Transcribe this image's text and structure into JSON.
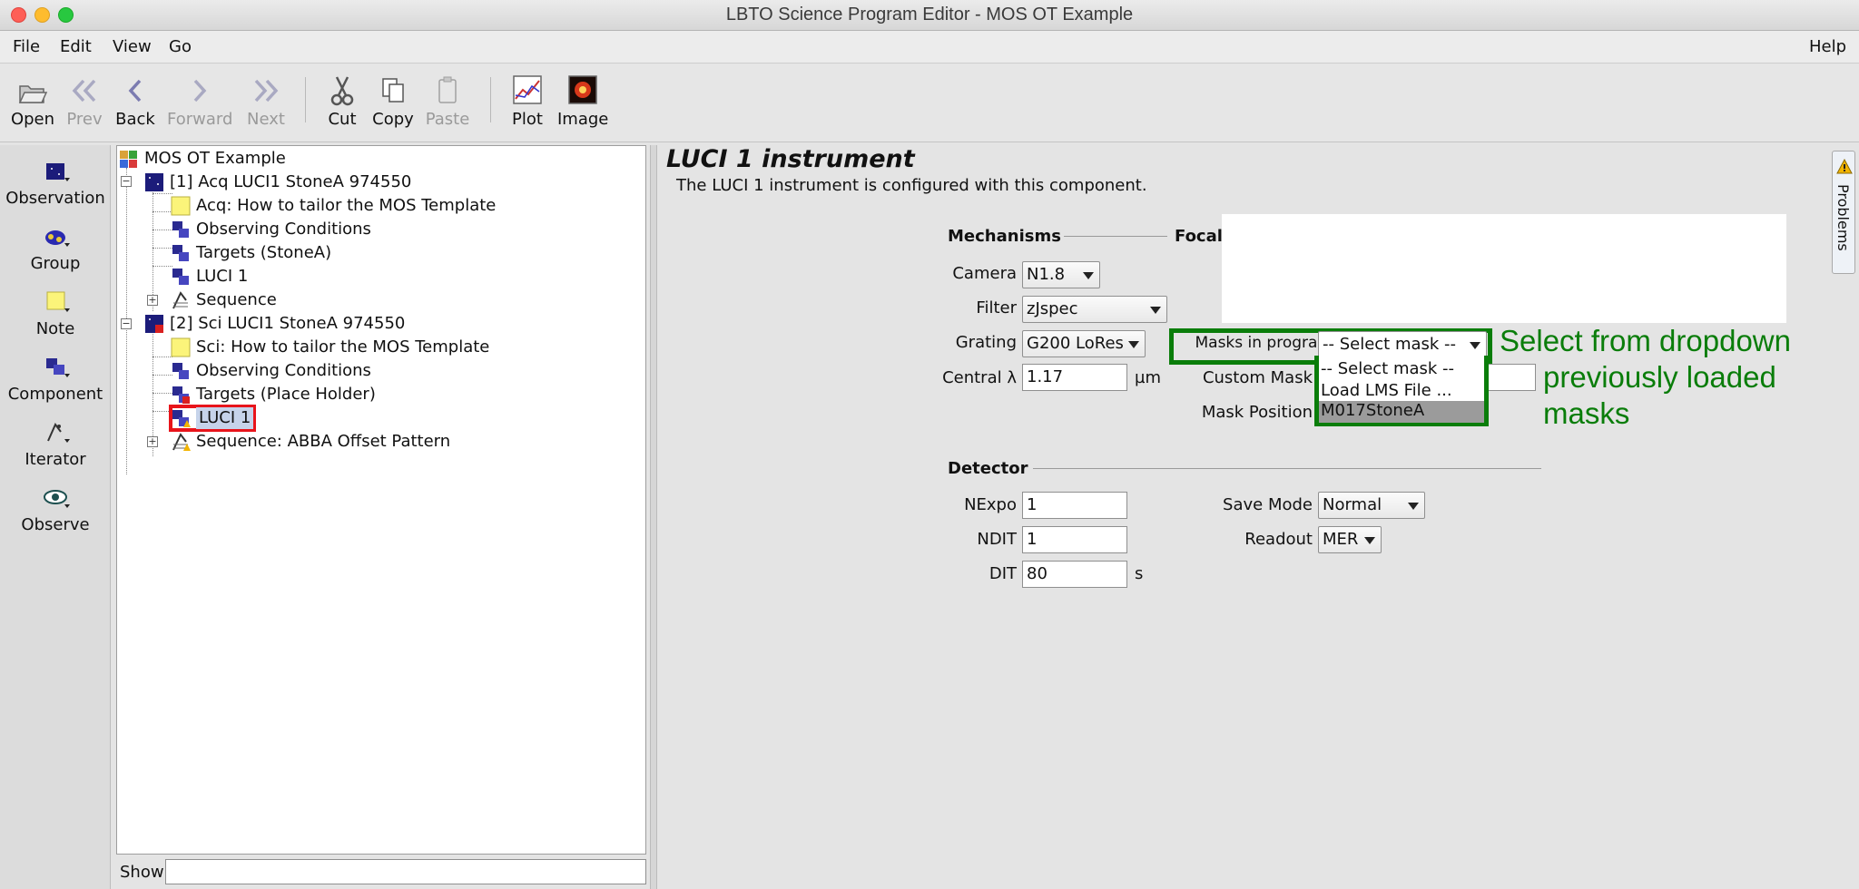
{
  "window": {
    "title": "LBTO Science Program Editor - MOS OT Example"
  },
  "menu": {
    "file": "File",
    "edit": "Edit",
    "view": "View",
    "go": "Go",
    "help": "Help"
  },
  "toolbar": {
    "open": "Open",
    "prev": "Prev",
    "back": "Back",
    "forward": "Forward",
    "next": "Next",
    "cut": "Cut",
    "copy": "Copy",
    "paste": "Paste",
    "plot": "Plot",
    "image": "Image"
  },
  "palette": {
    "observation": "Observation",
    "group": "Group",
    "note": "Note",
    "component": "Component",
    "iterator": "Iterator",
    "observe": "Observe"
  },
  "tree": {
    "root": "MOS OT Example",
    "obs1": "[1] Acq LUCI1 StoneA 974550",
    "obs1_note": "Acq: How to tailor the MOS Template",
    "obs1_conditions": "Observing Conditions",
    "obs1_targets": "Targets (StoneA)",
    "obs1_luci": "LUCI 1",
    "obs1_sequence": "Sequence",
    "obs2": "[2] Sci LUCI1 StoneA 974550",
    "obs2_note": "Sci: How to tailor the MOS Template",
    "obs2_conditions": "Observing Conditions",
    "obs2_targets": "Targets (Place Holder)",
    "obs2_luci": "LUCI 1",
    "obs2_sequence": "Sequence: ABBA Offset Pattern"
  },
  "show": {
    "label": "Show",
    "value": ""
  },
  "editor": {
    "heading": "LUCI 1 instrument",
    "description": "The LUCI 1 instrument is configured with this component.",
    "mechanisms": "Mechanisms",
    "focal": "Focal",
    "camera_label": "Camera",
    "camera_value": "N1.8",
    "filter_label": "Filter",
    "filter_value": "zJspec",
    "grating_label": "Grating",
    "grating_value": "G200 LoRes",
    "central_label": "Central λ",
    "central_value": "1.17",
    "central_unit": "µm",
    "masks_label": "Masks in program",
    "masks_value": "-- Select mask --",
    "mask_options": [
      "-- Select mask --",
      "Load LMS File ...",
      "M017StoneA"
    ],
    "custom_mask_label": "Custom Mask",
    "mask_position_label": "Mask Position",
    "detector": "Detector",
    "nexpo_label": "NExpo",
    "nexpo_value": "1",
    "ndit_label": "NDIT",
    "ndit_value": "1",
    "dit_label": "DIT",
    "dit_value": "80",
    "dit_unit": "s",
    "savemode_label": "Save Mode",
    "savemode_value": "Normal",
    "readout_label": "Readout",
    "readout_value": "MER"
  },
  "annotation": {
    "line1": "Select from dropdown",
    "line2": "previously loaded",
    "line3": "masks",
    "color": "#0a7d0a"
  },
  "problems": {
    "label": "Problems"
  },
  "colors": {
    "highlight_red": "#e8141b",
    "annotation_green": "#0a7d0a",
    "selection": "#c6d3ea"
  }
}
